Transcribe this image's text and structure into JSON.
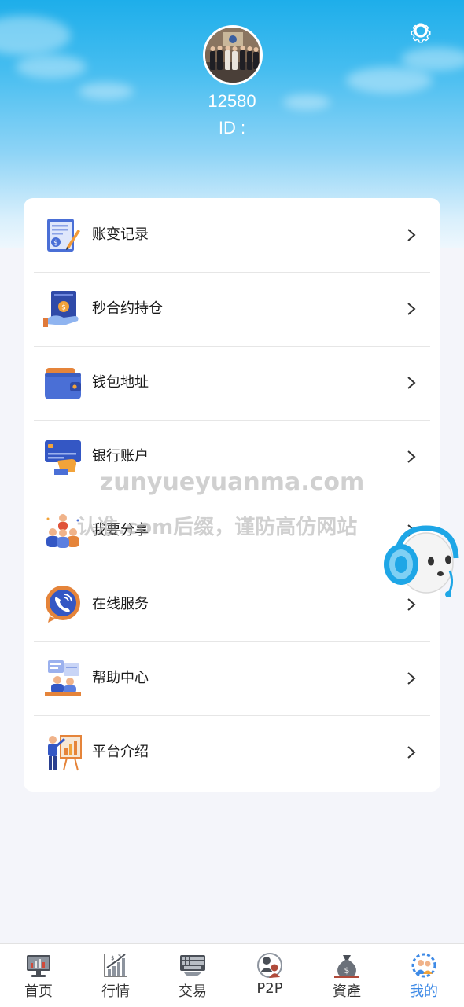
{
  "profile": {
    "username": "12580",
    "id_label": "ID :"
  },
  "menu": [
    {
      "label": "账变记录",
      "icon": "ledger-icon"
    },
    {
      "label": "秒合约持仓",
      "icon": "contract-icon"
    },
    {
      "label": "钱包地址",
      "icon": "wallet-icon"
    },
    {
      "label": "银行账户",
      "icon": "bank-card-icon"
    },
    {
      "label": "我要分享",
      "icon": "share-people-icon"
    },
    {
      "label": "在线服务",
      "icon": "phone-chat-icon"
    },
    {
      "label": "帮助中心",
      "icon": "help-center-icon"
    },
    {
      "label": "平台介绍",
      "icon": "presentation-icon"
    }
  ],
  "watermark": {
    "line1": "zunyueyuanma.com",
    "line2": "认准.com后缀，谨防高仿网站"
  },
  "bottom_nav": [
    {
      "label": "首页",
      "icon": "home-monitor-icon"
    },
    {
      "label": "行情",
      "icon": "market-chart-icon"
    },
    {
      "label": "交易",
      "icon": "keyboard-icon"
    },
    {
      "label": "P2P",
      "icon": "p2p-icon"
    },
    {
      "label": "資產",
      "icon": "money-bag-icon"
    },
    {
      "label": "我的",
      "icon": "my-people-icon"
    }
  ],
  "colors": {
    "header_top": "#1eaeea",
    "accent": "#3e8ae6",
    "background": "#f4f5fa"
  }
}
